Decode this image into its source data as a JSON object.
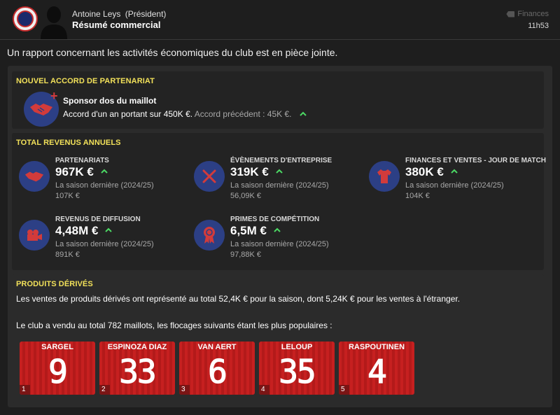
{
  "header": {
    "sender": "Antoine Leys",
    "sender_role": "(Président)",
    "subject": "Résumé commercial",
    "category": "Finances",
    "time": "11h53"
  },
  "intro": "Un rapport concernant les activités économiques du club est en pièce jointe.",
  "partnership": {
    "title": "NOUVEL ACCORD DE PARTENARIAT",
    "deal_name": "Sponsor dos du maillot",
    "deal_desc": "Accord d'un an portant sur 450K €.",
    "previous": "Accord précédent : 45K €."
  },
  "revenues": {
    "title": "TOTAL REVENUS ANNUELS",
    "items": [
      {
        "label": "PARTENARIATS",
        "value": "967K €",
        "prev_label": "La saison dernière (2024/25)",
        "prev_value": "107K €",
        "icon": "handshake-icon"
      },
      {
        "label": "ÉVÈNEMENTS D'ENTREPRISE",
        "value": "319K €",
        "prev_label": "La saison dernière (2024/25)",
        "prev_value": "56,09K €",
        "icon": "cutlery-icon"
      },
      {
        "label": "FINANCES ET VENTES - JOUR DE MATCH",
        "value": "380K €",
        "prev_label": "La saison dernière (2024/25)",
        "prev_value": "104K €",
        "icon": "shirt-icon"
      },
      {
        "label": "REVENUS DE DIFFUSION",
        "value": "4,48M €",
        "prev_label": "La saison dernière (2024/25)",
        "prev_value": "891K €",
        "icon": "camera-icon"
      },
      {
        "label": "PRIMES DE COMPÉTITION",
        "value": "6,5M €",
        "prev_label": "La saison dernière (2024/25)",
        "prev_value": "97,88K €",
        "icon": "medal-icon"
      }
    ]
  },
  "merchandise": {
    "title": "PRODUITS DÉRIVÉS",
    "text1": "Les ventes de produits dérivés ont représenté au total 52,4K € pour la saison, dont 5,24K € pour les ventes à l'étranger.",
    "text2": "Le club a vendu au total 782 maillots, les flocages suivants étant les plus populaires :",
    "shirts": [
      {
        "name": "SARGEL",
        "number": "9",
        "rank": "1"
      },
      {
        "name": "ESPINOZA DIAZ",
        "number": "33",
        "rank": "2"
      },
      {
        "name": "VAN AERT",
        "number": "6",
        "rank": "3"
      },
      {
        "name": "LELOUP",
        "number": "35",
        "rank": "4"
      },
      {
        "name": "RASPOUTINEN",
        "number": "4",
        "rank": "5"
      }
    ]
  },
  "colors": {
    "accent_yellow": "#f2e15a",
    "icon_circle": "#2c3f85",
    "icon_red": "#d23b3b",
    "up_arrow": "#4cd964",
    "shirt_red": "#c62020"
  }
}
